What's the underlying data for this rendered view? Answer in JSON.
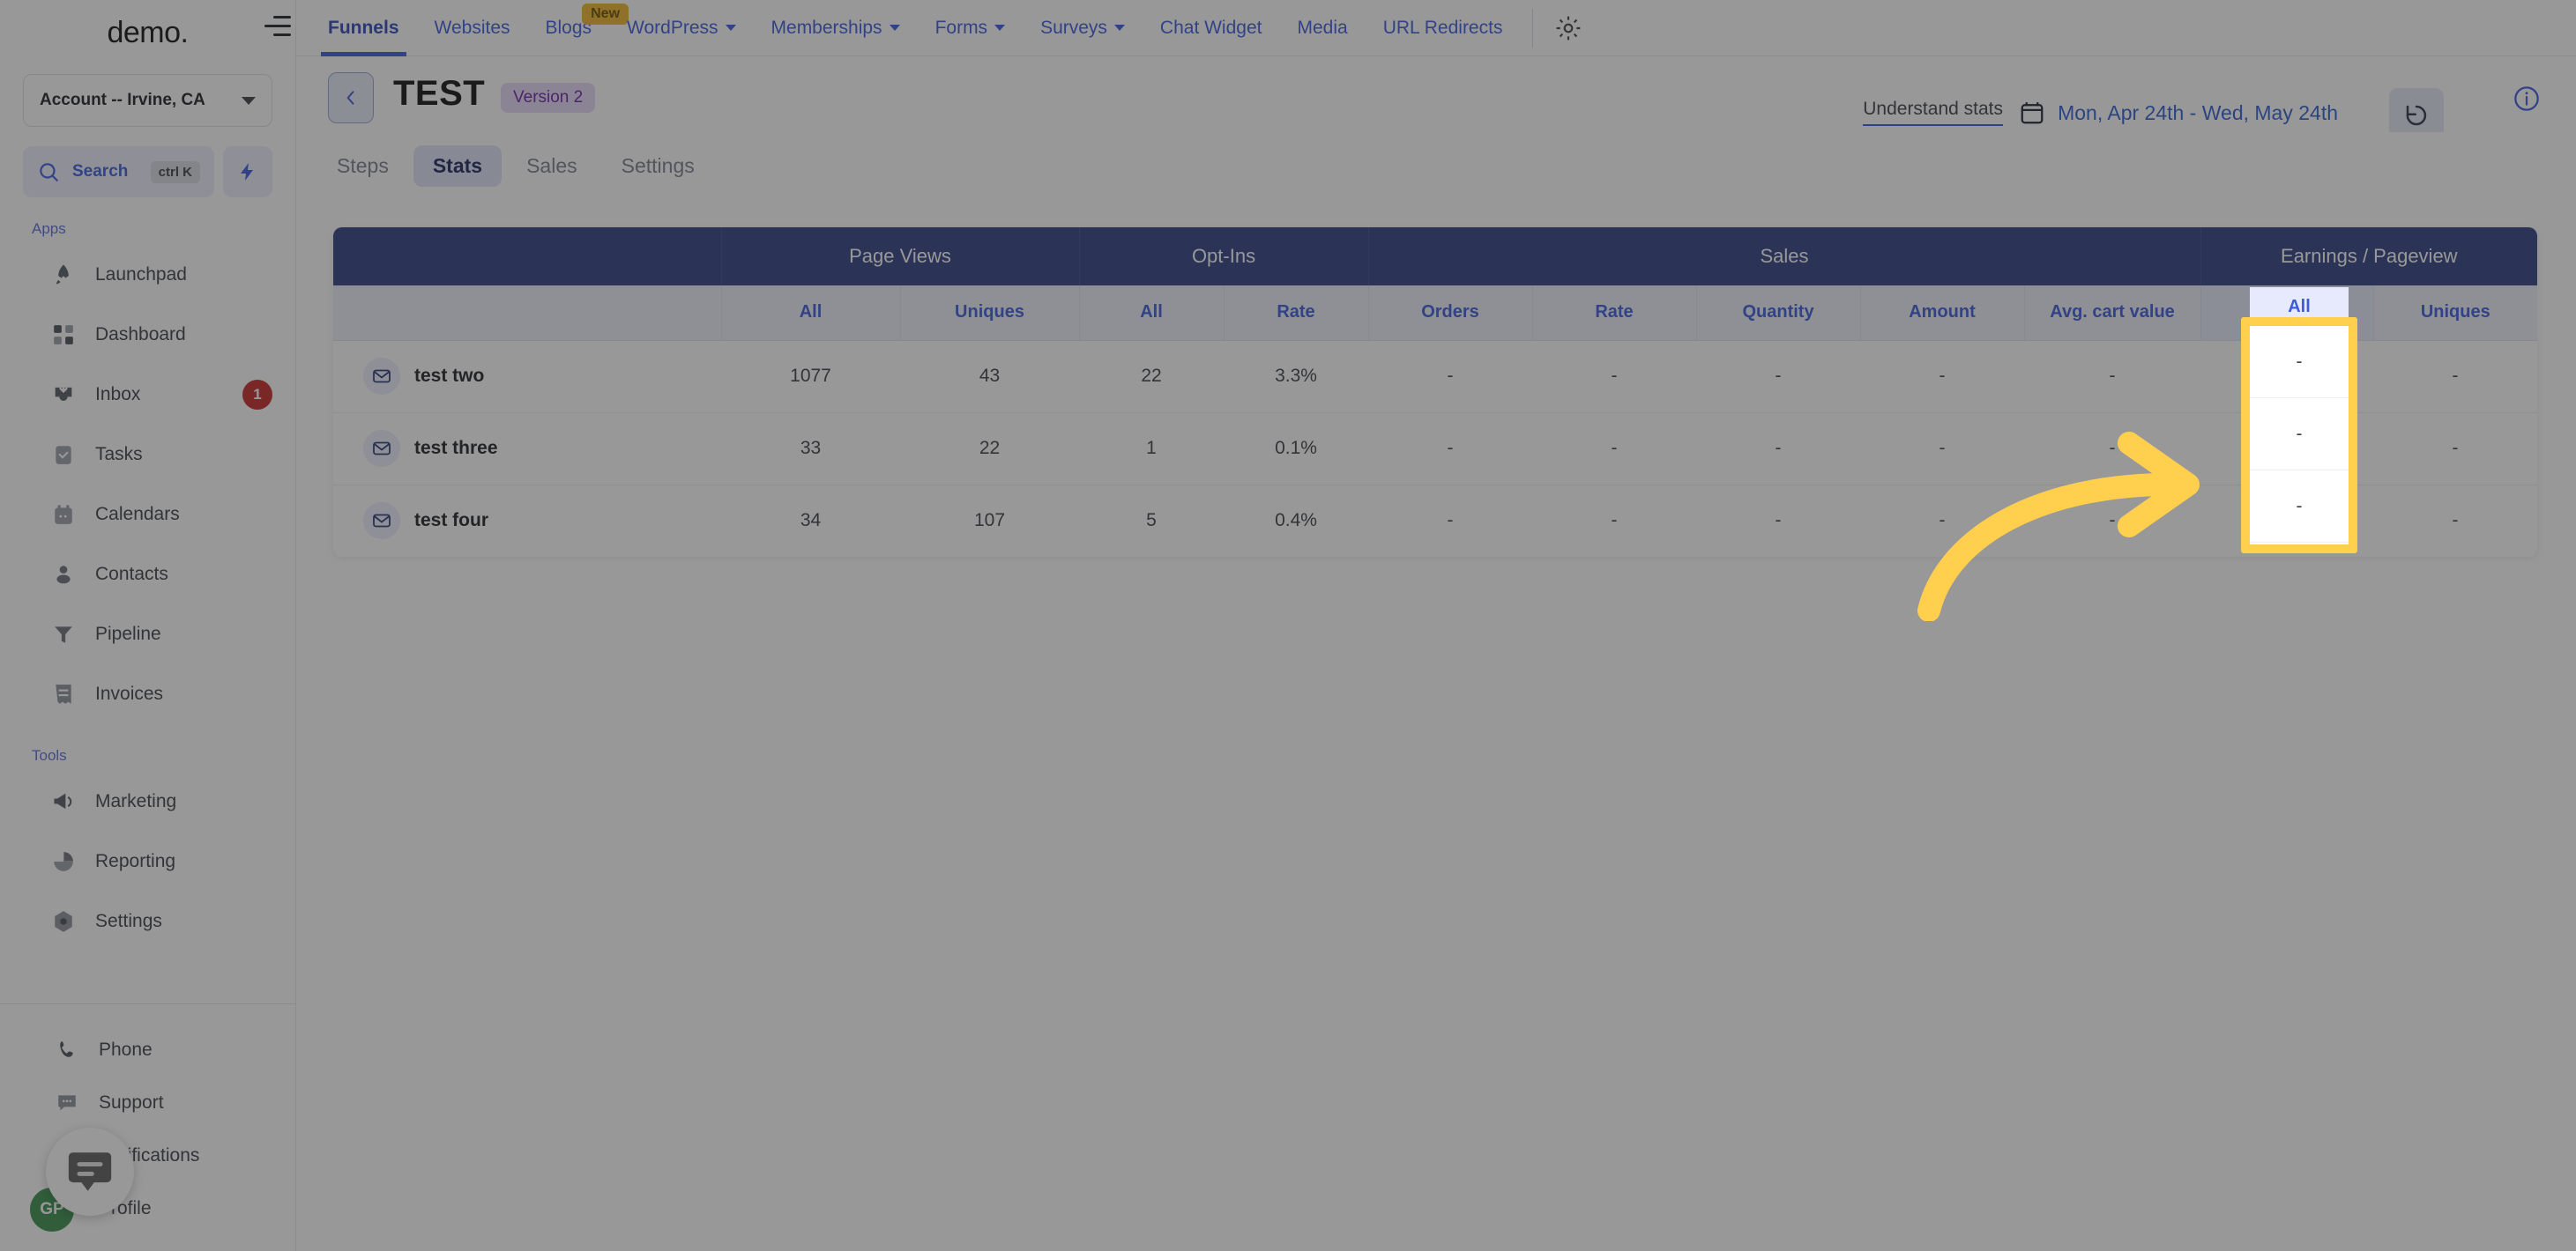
{
  "sidebar": {
    "logo": "demo",
    "account": {
      "label": "Account -- Irvine, CA",
      "chevron_icon": "chevron-down-icon"
    },
    "search": {
      "label": "Search",
      "shortcut": "ctrl K",
      "icon": "search-icon",
      "bolt_icon": "bolt-icon"
    },
    "sections": [
      {
        "title": "Apps",
        "items": [
          {
            "label": "Launchpad",
            "icon": "rocket-icon",
            "badge": ""
          },
          {
            "label": "Dashboard",
            "icon": "grid-icon",
            "badge": ""
          },
          {
            "label": "Inbox",
            "icon": "inbox-icon",
            "badge": "1"
          },
          {
            "label": "Tasks",
            "icon": "clipboard-check-icon",
            "badge": ""
          },
          {
            "label": "Calendars",
            "icon": "calendar-icon",
            "badge": ""
          },
          {
            "label": "Contacts",
            "icon": "person-icon",
            "badge": ""
          },
          {
            "label": "Pipeline",
            "icon": "funnel-icon",
            "badge": ""
          },
          {
            "label": "Invoices",
            "icon": "invoice-icon",
            "badge": ""
          }
        ]
      },
      {
        "title": "Tools",
        "items": [
          {
            "label": "Marketing",
            "icon": "megaphone-icon",
            "badge": ""
          },
          {
            "label": "Reporting",
            "icon": "pie-chart-icon",
            "badge": ""
          },
          {
            "label": "Settings",
            "icon": "gear-icon",
            "badge": ""
          }
        ]
      }
    ],
    "bottom_items": [
      {
        "label": "Phone",
        "icon": "phone-icon"
      },
      {
        "label": "Support",
        "icon": "chat-dots-icon"
      },
      {
        "label": "Notifications",
        "icon": "bell-icon"
      },
      {
        "label": "Profile",
        "icon": "avatar-icon"
      }
    ],
    "avatar_initials": "GP",
    "chat_widget_icon": "chat-bubble-icon"
  },
  "topnav": {
    "hamburger_icon": "hamburger-icon",
    "gear_icon": "gear-icon",
    "items": [
      {
        "label": "Funnels",
        "active": true,
        "caret": false,
        "badge": ""
      },
      {
        "label": "Websites",
        "active": false,
        "caret": false,
        "badge": ""
      },
      {
        "label": "Blogs",
        "active": false,
        "caret": false,
        "badge": "New"
      },
      {
        "label": "WordPress",
        "active": false,
        "caret": true,
        "badge": ""
      },
      {
        "label": "Memberships",
        "active": false,
        "caret": true,
        "badge": ""
      },
      {
        "label": "Forms",
        "active": false,
        "caret": true,
        "badge": ""
      },
      {
        "label": "Surveys",
        "active": false,
        "caret": true,
        "badge": ""
      },
      {
        "label": "Chat Widget",
        "active": false,
        "caret": false,
        "badge": ""
      },
      {
        "label": "Media",
        "active": false,
        "caret": false,
        "badge": ""
      },
      {
        "label": "URL Redirects",
        "active": false,
        "caret": false,
        "badge": ""
      }
    ]
  },
  "header": {
    "back_icon": "chevron-left-icon",
    "title": "TEST",
    "version_badge": "Version 2",
    "understand_stats": "Understand stats",
    "calendar_icon": "calendar-icon",
    "date_range": "Mon, Apr 24th - Wed, May 24th",
    "refresh_icon": "refresh-icon",
    "info_icon": "info-icon"
  },
  "tabs": [
    {
      "label": "Steps",
      "active": false
    },
    {
      "label": "Stats",
      "active": true
    },
    {
      "label": "Sales",
      "active": false
    },
    {
      "label": "Settings",
      "active": false
    }
  ],
  "table": {
    "group_headers": [
      {
        "label": "",
        "span": 1
      },
      {
        "label": "Page Views",
        "span": 2
      },
      {
        "label": "Opt-Ins",
        "span": 2
      },
      {
        "label": "Sales",
        "span": 5
      },
      {
        "label": "Earnings / Pageview",
        "span": 2
      }
    ],
    "columns": [
      "",
      "All",
      "Uniques",
      "All",
      "Rate",
      "Orders",
      "Rate",
      "Quantity",
      "Amount",
      "Avg. cart value",
      "All",
      "Uniques"
    ],
    "highlighted_column_index": 10,
    "highlighted_column_label": "All",
    "row_icon": "envelope-icon",
    "rows": [
      {
        "name": "test two",
        "values": [
          "1077",
          "43",
          "22",
          "3.3%",
          "-",
          "-",
          "-",
          "-",
          "-",
          "-",
          "-"
        ]
      },
      {
        "name": "test three",
        "values": [
          "33",
          "22",
          "1",
          "0.1%",
          "-",
          "-",
          "-",
          "-",
          "-",
          "-",
          "-"
        ]
      },
      {
        "name": "test four",
        "values": [
          "34",
          "107",
          "5",
          "0.4%",
          "-",
          "-",
          "-",
          "-",
          "-",
          "-",
          "-"
        ]
      }
    ]
  },
  "annotation": {
    "arrow_color": "#ffcf4d",
    "highlight_color": "#ffcf4d",
    "arrow_icon": "curved-arrow-right-icon"
  },
  "colors": {
    "accent": "#3b5bdb",
    "table_group_header": "#2e3f7f",
    "highlight": "#ffcf4d",
    "badge_red": "#c62828"
  }
}
